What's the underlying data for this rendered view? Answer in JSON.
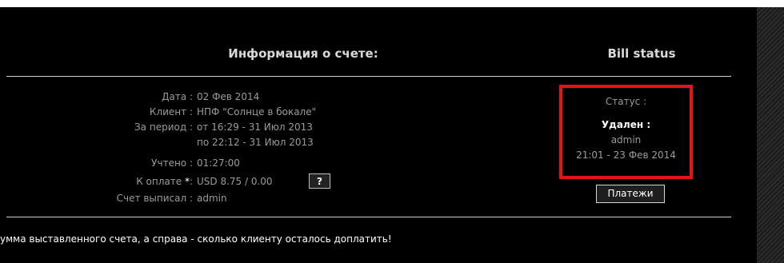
{
  "info": {
    "title": "Информация о счете:",
    "rows": [
      {
        "label": "Дата :",
        "value": "02 Фев 2014"
      },
      {
        "label": "Клиент :",
        "value": "НПФ \"Солнце в бокале\""
      },
      {
        "label": "За период :",
        "value": "от 16:29 - 31 Июл 2013"
      },
      {
        "label": "",
        "value": "по 22:12 - 31 Июл 2013"
      },
      {
        "label": "Учтено :",
        "value": "01:27:00"
      },
      {
        "label": "К оплате",
        "label_star": "*",
        "label_colon": ":",
        "value": "USD 8.75 / 0.00"
      },
      {
        "label": "Счет выписал :",
        "value": "admin"
      }
    ],
    "help_button": "?"
  },
  "status": {
    "title": "Bill status",
    "label": "Статус :",
    "state": "Удален :",
    "user": "admin",
    "date": "21:01 - 23 Фев 2014",
    "highlight_color": "#e41414"
  },
  "payments_button": "Платежи",
  "footnote": "умма выставленного счета, а справа - сколько клиенту осталось доплатить!"
}
